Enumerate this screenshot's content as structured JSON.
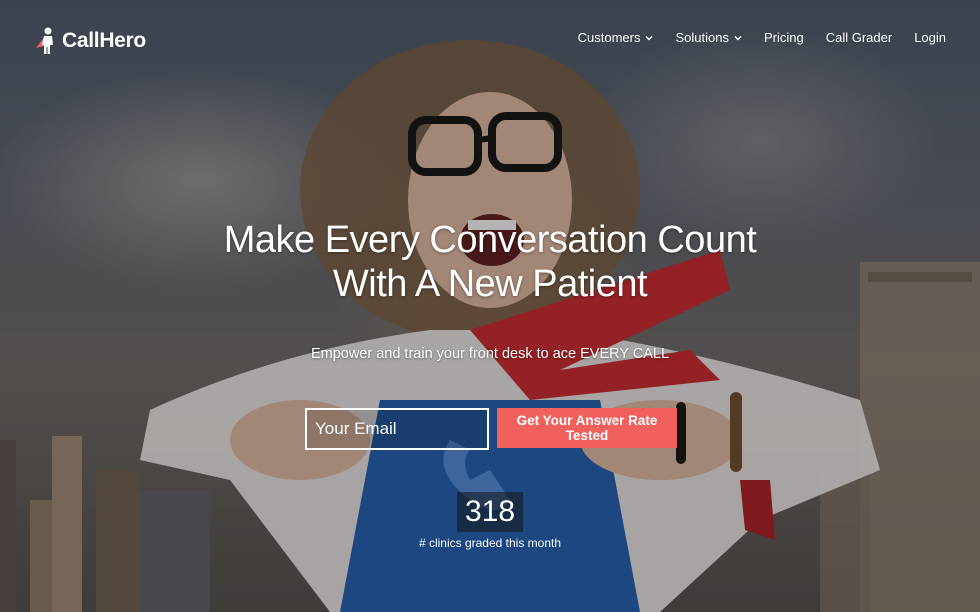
{
  "brand": {
    "name": "CallHero",
    "logo_icon": "caped-hero-icon",
    "accent_color": "#f0605c"
  },
  "nav": {
    "items": [
      {
        "label": "Customers",
        "has_dropdown": true
      },
      {
        "label": "Solutions",
        "has_dropdown": true
      },
      {
        "label": "Pricing",
        "has_dropdown": false
      },
      {
        "label": "Call Grader",
        "has_dropdown": false
      },
      {
        "label": "Login",
        "has_dropdown": false
      }
    ]
  },
  "hero": {
    "headline_line1": "Make Every Conversation Count",
    "headline_line2": "With A New Patient",
    "subheadline": "Empower and train your front desk to ace EVERY CALL",
    "email_placeholder": "Your Email",
    "cta_label": "Get Your Answer Rate Tested",
    "stat_value": "318",
    "stat_label": "# clinics graded this month"
  }
}
